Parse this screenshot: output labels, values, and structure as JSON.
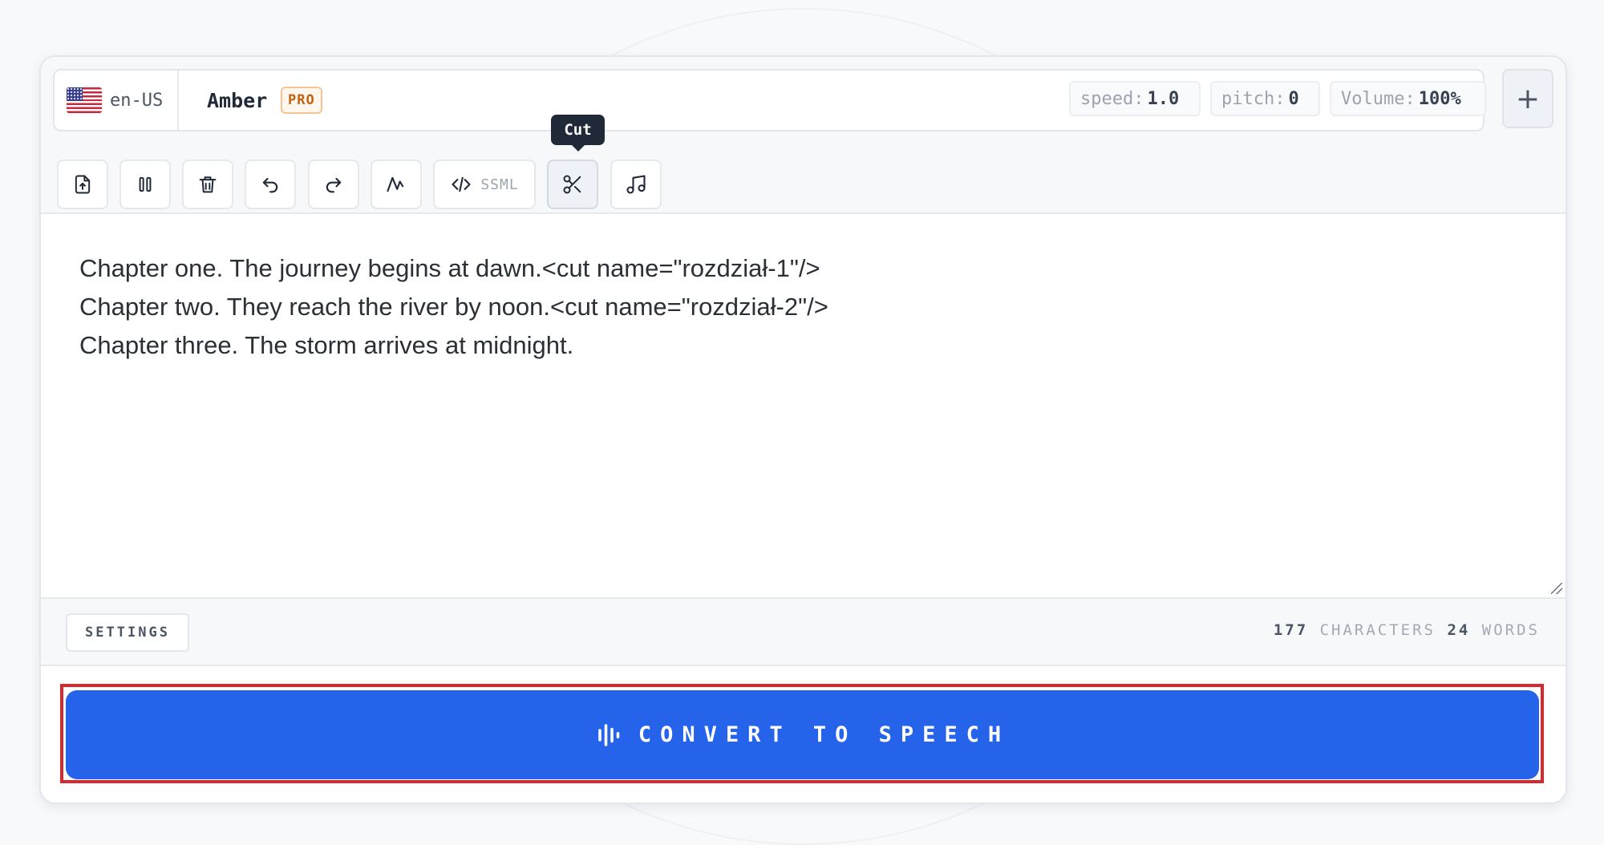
{
  "voice": {
    "locale": "en-US",
    "name": "Amber",
    "badge": "PRO"
  },
  "params": {
    "speed_label": "speed:",
    "speed_value": "1.0",
    "pitch_label": "pitch:",
    "pitch_value": "0",
    "volume_label": "Volume:",
    "volume_value": "100%"
  },
  "toolbar": {
    "ssml_label": "SSML",
    "tooltip": "Cut",
    "icons": [
      "upload-file-icon",
      "pause-icon",
      "trash-icon",
      "undo-icon",
      "redo-icon",
      "waveform-icon",
      "code-icon",
      "scissors-icon",
      "music-note-icon"
    ]
  },
  "editor": {
    "text": "Chapter one. The journey begins at dawn.<cut name=\"rozdział-1\"/>\nChapter two. They reach the river by noon.<cut name=\"rozdział-2\"/>\nChapter three. The storm arrives at midnight."
  },
  "footer": {
    "settings_label": "SETTINGS",
    "char_count": "177",
    "char_label": "CHARACTERS",
    "word_count": "24",
    "word_label": "WORDS"
  },
  "convert": {
    "label": "CONVERT TO SPEECH"
  },
  "colors": {
    "accent": "#2563eb",
    "highlight": "#d42a2f"
  }
}
